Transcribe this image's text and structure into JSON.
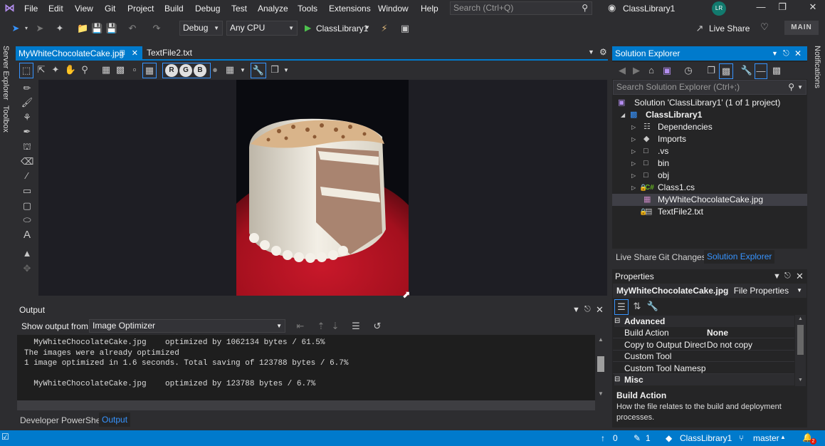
{
  "menu": {
    "items": [
      "File",
      "Edit",
      "View",
      "Git",
      "Project",
      "Build",
      "Debug",
      "Test",
      "Analyze",
      "Tools",
      "Extensions",
      "Window",
      "Help"
    ]
  },
  "titlebar": {
    "search_placeholder": "Search (Ctrl+Q)",
    "app_title": "ClassLibrary1",
    "avatar_initials": "LR"
  },
  "toolbar": {
    "config": "Debug",
    "platform": "Any CPU",
    "run_target": "ClassLibrary1",
    "live_share": "Live Share",
    "badge": "MAIN"
  },
  "left_strip": {
    "server_explorer": "Server Explorer",
    "toolbox": "Toolbox"
  },
  "right_strip": {
    "notifications": "Notifications"
  },
  "doc_tabs": {
    "active": "MyWhiteChocolateCake.jpg",
    "other": "TextFile2.txt"
  },
  "image_editor": {
    "channel_buttons": [
      "R",
      "G",
      "B"
    ]
  },
  "output": {
    "title": "Output",
    "show_from_label": "Show output from:",
    "source": "Image Optimizer",
    "lines": [
      "  MyWhiteChocolateCake.jpg    optimized by 1062134 bytes / 61.5%",
      "The images were already optimized",
      "1 image optimized in 1.6 seconds. Total saving of 123788 bytes / 6.7%",
      "",
      "  MyWhiteChocolateCake.jpg    optimized by 123788 bytes / 6.7%"
    ],
    "tabs": [
      "Developer PowerShell",
      "Output"
    ]
  },
  "solution_explorer": {
    "title": "Solution Explorer",
    "search_placeholder": "Search Solution Explorer (Ctrl+;)",
    "tree": [
      {
        "label": "Solution 'ClassLibrary1' (1 of 1 project)",
        "indent": 0,
        "arrow": "",
        "icon": "solution-icon",
        "bold": false
      },
      {
        "label": "ClassLibrary1",
        "indent": 1,
        "arrow": "open",
        "icon": "csproj-icon",
        "bold": true
      },
      {
        "label": "Dependencies",
        "indent": 2,
        "arrow": "closed",
        "icon": "dependencies-icon",
        "bold": false
      },
      {
        "label": "Imports",
        "indent": 2,
        "arrow": "closed",
        "icon": "imports-icon",
        "bold": false
      },
      {
        "label": ".vs",
        "indent": 2,
        "arrow": "closed",
        "icon": "folder-icon",
        "bold": false
      },
      {
        "label": "bin",
        "indent": 2,
        "arrow": "closed",
        "icon": "folder-icon",
        "bold": false
      },
      {
        "label": "obj",
        "indent": 2,
        "arrow": "closed",
        "icon": "folder-icon",
        "bold": false
      },
      {
        "label": "Class1.cs",
        "indent": 2,
        "arrow": "closed",
        "icon": "csharp-file-icon",
        "bold": false
      },
      {
        "label": "MyWhiteChocolateCake.jpg",
        "indent": 2,
        "arrow": "",
        "icon": "image-file-icon",
        "bold": false,
        "selected": true
      },
      {
        "label": "TextFile2.txt",
        "indent": 2,
        "arrow": "",
        "icon": "text-file-icon",
        "bold": false
      }
    ],
    "bottom_tabs": [
      "Live Share",
      "Git Changes",
      "Solution Explorer"
    ]
  },
  "properties": {
    "title": "Properties",
    "object_name": "MyWhiteChocolateCake.jpg",
    "object_type": "File Properties",
    "categories": [
      {
        "name": "Advanced",
        "rows": [
          {
            "name": "Build Action",
            "value": "None"
          },
          {
            "name": "Copy to Output Directory",
            "value": "Do not copy"
          },
          {
            "name": "Custom Tool",
            "value": ""
          },
          {
            "name": "Custom Tool Namespace",
            "value": ""
          }
        ]
      },
      {
        "name": "Misc",
        "rows": []
      }
    ],
    "desc_title": "Build Action",
    "desc_text": "How the file relates to the build and deployment processes."
  },
  "statusbar": {
    "up_count": "0",
    "pencil_count": "1",
    "project": "ClassLibrary1",
    "branch": "master",
    "notifications": "2"
  },
  "colors": {
    "accent": "#007acc",
    "background": "#2d2d30",
    "editor": "#1e1e1e"
  }
}
